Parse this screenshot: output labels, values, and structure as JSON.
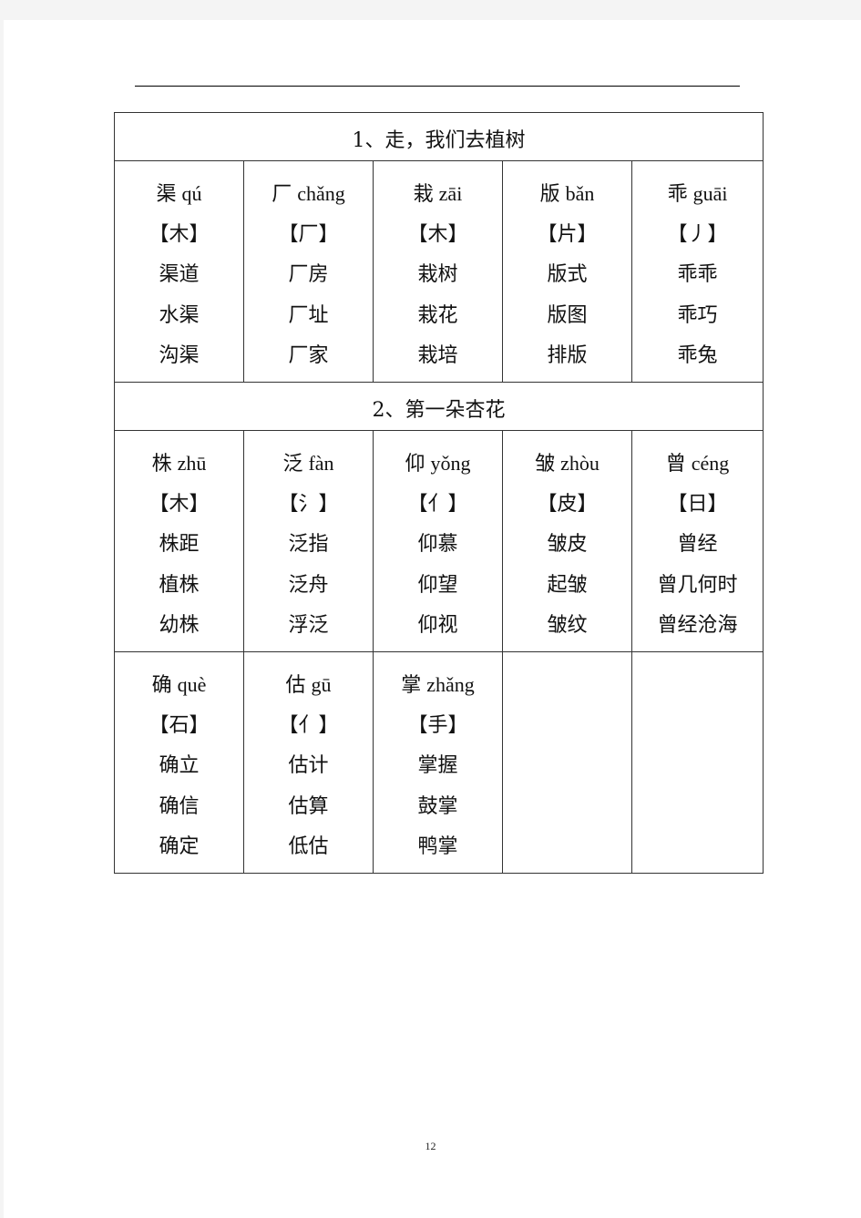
{
  "page_number": "12",
  "sections": [
    {
      "title": "1、走，我们去植树",
      "rows": [
        [
          {
            "char": "渠",
            "pinyin": "qú",
            "radical": "【木】",
            "words": [
              "渠道",
              "水渠",
              "沟渠"
            ]
          },
          {
            "char": "厂",
            "pinyin": "chǎng",
            "radical": "【厂】",
            "words": [
              "厂房",
              "厂址",
              "厂家"
            ]
          },
          {
            "char": "栽",
            "pinyin": "zāi",
            "radical": "【木】",
            "words": [
              "栽树",
              "栽花",
              "栽培"
            ]
          },
          {
            "char": "版",
            "pinyin": "bǎn",
            "radical": "【片】",
            "words": [
              "版式",
              "版图",
              "排版"
            ]
          },
          {
            "char": "乖",
            "pinyin": "guāi",
            "radical": "【丿】",
            "words": [
              "乖乖",
              "乖巧",
              "乖兔"
            ]
          }
        ]
      ]
    },
    {
      "title": "2、第一朵杏花",
      "rows": [
        [
          {
            "char": "株",
            "pinyin": "zhū",
            "radical": "【木】",
            "words": [
              "株距",
              "植株",
              "幼株"
            ]
          },
          {
            "char": "泛",
            "pinyin": "fàn",
            "radical": "【氵】",
            "words": [
              "泛指",
              "泛舟",
              "浮泛"
            ]
          },
          {
            "char": "仰",
            "pinyin": "yǒng",
            "radical": "【亻】",
            "words": [
              "仰慕",
              "仰望",
              "仰视"
            ]
          },
          {
            "char": "皱",
            "pinyin": "zhòu",
            "radical": "【皮】",
            "words": [
              "皱皮",
              "起皱",
              "皱纹"
            ]
          },
          {
            "char": "曾",
            "pinyin": "céng",
            "radical": "【日】",
            "words": [
              "曾经",
              "曾几何时",
              "曾经沧海"
            ]
          }
        ],
        [
          {
            "char": "确",
            "pinyin": "què",
            "radical": "【石】",
            "words": [
              "确立",
              "确信",
              "确定"
            ]
          },
          {
            "char": "估",
            "pinyin": "gū",
            "radical": "【亻】",
            "words": [
              "估计",
              "估算",
              "低估"
            ]
          },
          {
            "char": "掌",
            "pinyin": "zhǎng",
            "radical": "【手】",
            "words": [
              "掌握",
              "鼓掌",
              "鸭掌"
            ]
          },
          null,
          null
        ]
      ]
    }
  ]
}
